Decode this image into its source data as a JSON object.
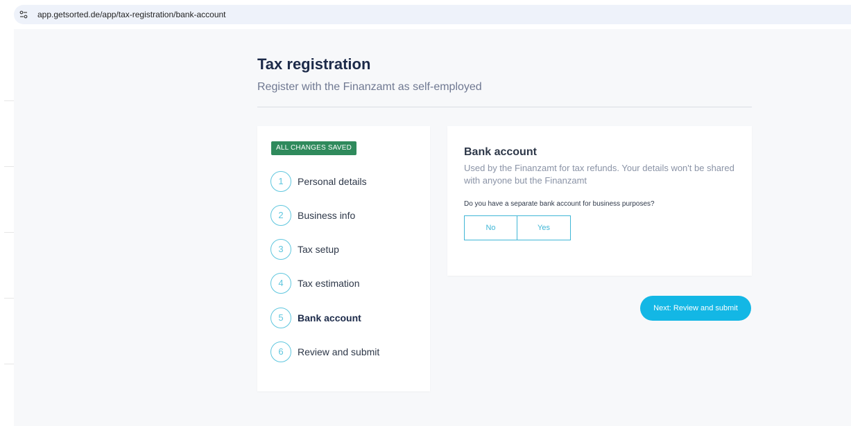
{
  "browser": {
    "url": "app.getsorted.de/app/tax-registration/bank-account",
    "site_icon": "tune-icon"
  },
  "header": {
    "title": "Tax registration",
    "subtitle": "Register with the Finanzamt as self-employed"
  },
  "steps": {
    "saved_badge": "ALL CHANGES SAVED",
    "accent_color": "#5ec6de",
    "items": [
      {
        "num": "1",
        "label": "Personal details"
      },
      {
        "num": "2",
        "label": "Business info"
      },
      {
        "num": "3",
        "label": "Tax setup"
      },
      {
        "num": "4",
        "label": "Tax estimation"
      },
      {
        "num": "5",
        "label": "Bank account",
        "active": true
      },
      {
        "num": "6",
        "label": "Review and submit"
      }
    ]
  },
  "bank_account": {
    "title": "Bank account",
    "description": "Used by the Finanzamt for tax refunds. Your details won't be shared with anyone but the Finanzamt",
    "question": "Do you have a separate bank account for business purposes?",
    "options": [
      "No",
      "Yes"
    ]
  },
  "actions": {
    "next_label": "Next: Review and submit",
    "next_color": "#13b7e5"
  }
}
